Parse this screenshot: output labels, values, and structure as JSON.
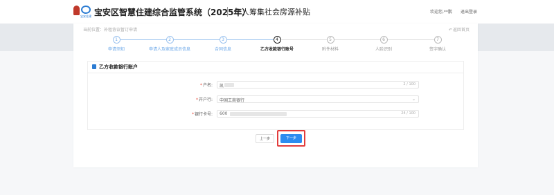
{
  "header": {
    "logo_text": "宝安住建",
    "system_title": "宝安区智慧住建综合监管系统（2025年）",
    "page_title": "个人筹集社会房源补贴",
    "welcome_text": "欢迎您,**鹏",
    "logout_label": "退出登录"
  },
  "breadcrumb": {
    "text": "当前位置：补租协议暂订申请",
    "back_label": "返回首页"
  },
  "steps": [
    {
      "number": "1",
      "label": "申请须知",
      "state": "done"
    },
    {
      "number": "2",
      "label": "申请人及家庭成员信息",
      "state": "done"
    },
    {
      "number": "3",
      "label": "合同信息",
      "state": "done"
    },
    {
      "number": "4",
      "label": "乙方收款银行账号",
      "state": "active"
    },
    {
      "number": "5",
      "label": "附件材料",
      "state": "future"
    },
    {
      "number": "6",
      "label": "人脸识别",
      "state": "future"
    },
    {
      "number": "7",
      "label": "签字确认",
      "state": "future"
    }
  ],
  "section": {
    "title": "乙方收款银行账户",
    "fields": [
      {
        "label": "户名:",
        "value": "凯",
        "count": "2 / 100"
      },
      {
        "label": "开户行:",
        "value": "中国工商银行",
        "count": ""
      },
      {
        "label": "银行卡号:",
        "value": "600",
        "count": "24 / 100"
      }
    ]
  },
  "buttons": {
    "prev_label": "上一步",
    "next_label": "下一步"
  },
  "colors": {
    "accent": "#2d8cf0",
    "highlight": "#e23c3c",
    "completed_step": "#6aa7e8"
  }
}
